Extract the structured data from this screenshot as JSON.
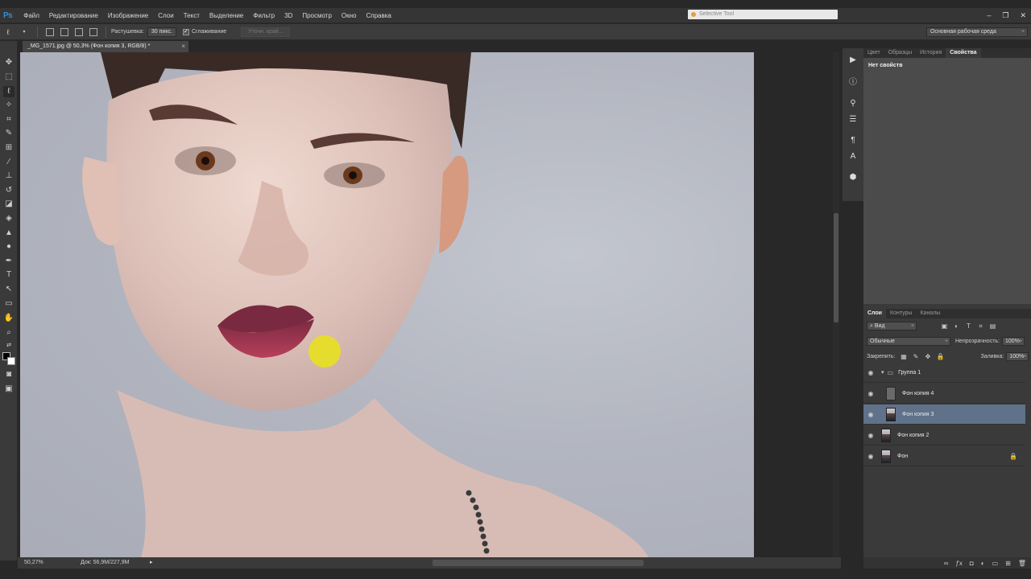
{
  "app": {
    "logo": "Ps",
    "menu": [
      "Файл",
      "Редактирование",
      "Изображение",
      "Слои",
      "Текст",
      "Выделение",
      "Фильтр",
      "3D",
      "Просмотр",
      "Окно",
      "Справка"
    ],
    "tool_search_placeholder": "Selective Tool",
    "window_controls": [
      "–",
      "❐",
      "✕"
    ]
  },
  "options_bar": {
    "feather_label": "Растушевка:",
    "feather_value": "30 пикс.",
    "antialias_label": "Сглаживание",
    "refine_edge_label": "Уточн. край...",
    "workspace": "Основная рабочая среда"
  },
  "document": {
    "tab_title": "_MG_1571.jpg @ 50,3% (Фон копия 3, RGB/8) *",
    "tab_close": "×"
  },
  "status": {
    "zoom": "50,27%",
    "doc_size": "Док: 56,9M/227,9M",
    "arrow": "▸"
  },
  "panels": {
    "top_tabs": [
      "Цвет",
      "Образцы",
      "История",
      "Свойства"
    ],
    "active_top_tab": "Свойства",
    "no_properties": "Нет свойств",
    "layer_tabs": [
      "Слои",
      "Контуры",
      "Каналы"
    ],
    "filter_kind": "Вид",
    "blend_mode": "Обычные",
    "opacity_label": "Непрозрачность:",
    "opacity_value": "100%",
    "lock_label": "Закрепить:",
    "fill_label": "Заливка:",
    "fill_value": "100%",
    "layers": [
      {
        "name": "Группа 1",
        "type": "group"
      },
      {
        "name": "Фон копия 4",
        "type": "gray"
      },
      {
        "name": "Фон копия 3",
        "type": "photo",
        "selected": true
      },
      {
        "name": "Фон копия 2",
        "type": "photo"
      },
      {
        "name": "Фон",
        "type": "photo",
        "locked": true
      }
    ]
  }
}
